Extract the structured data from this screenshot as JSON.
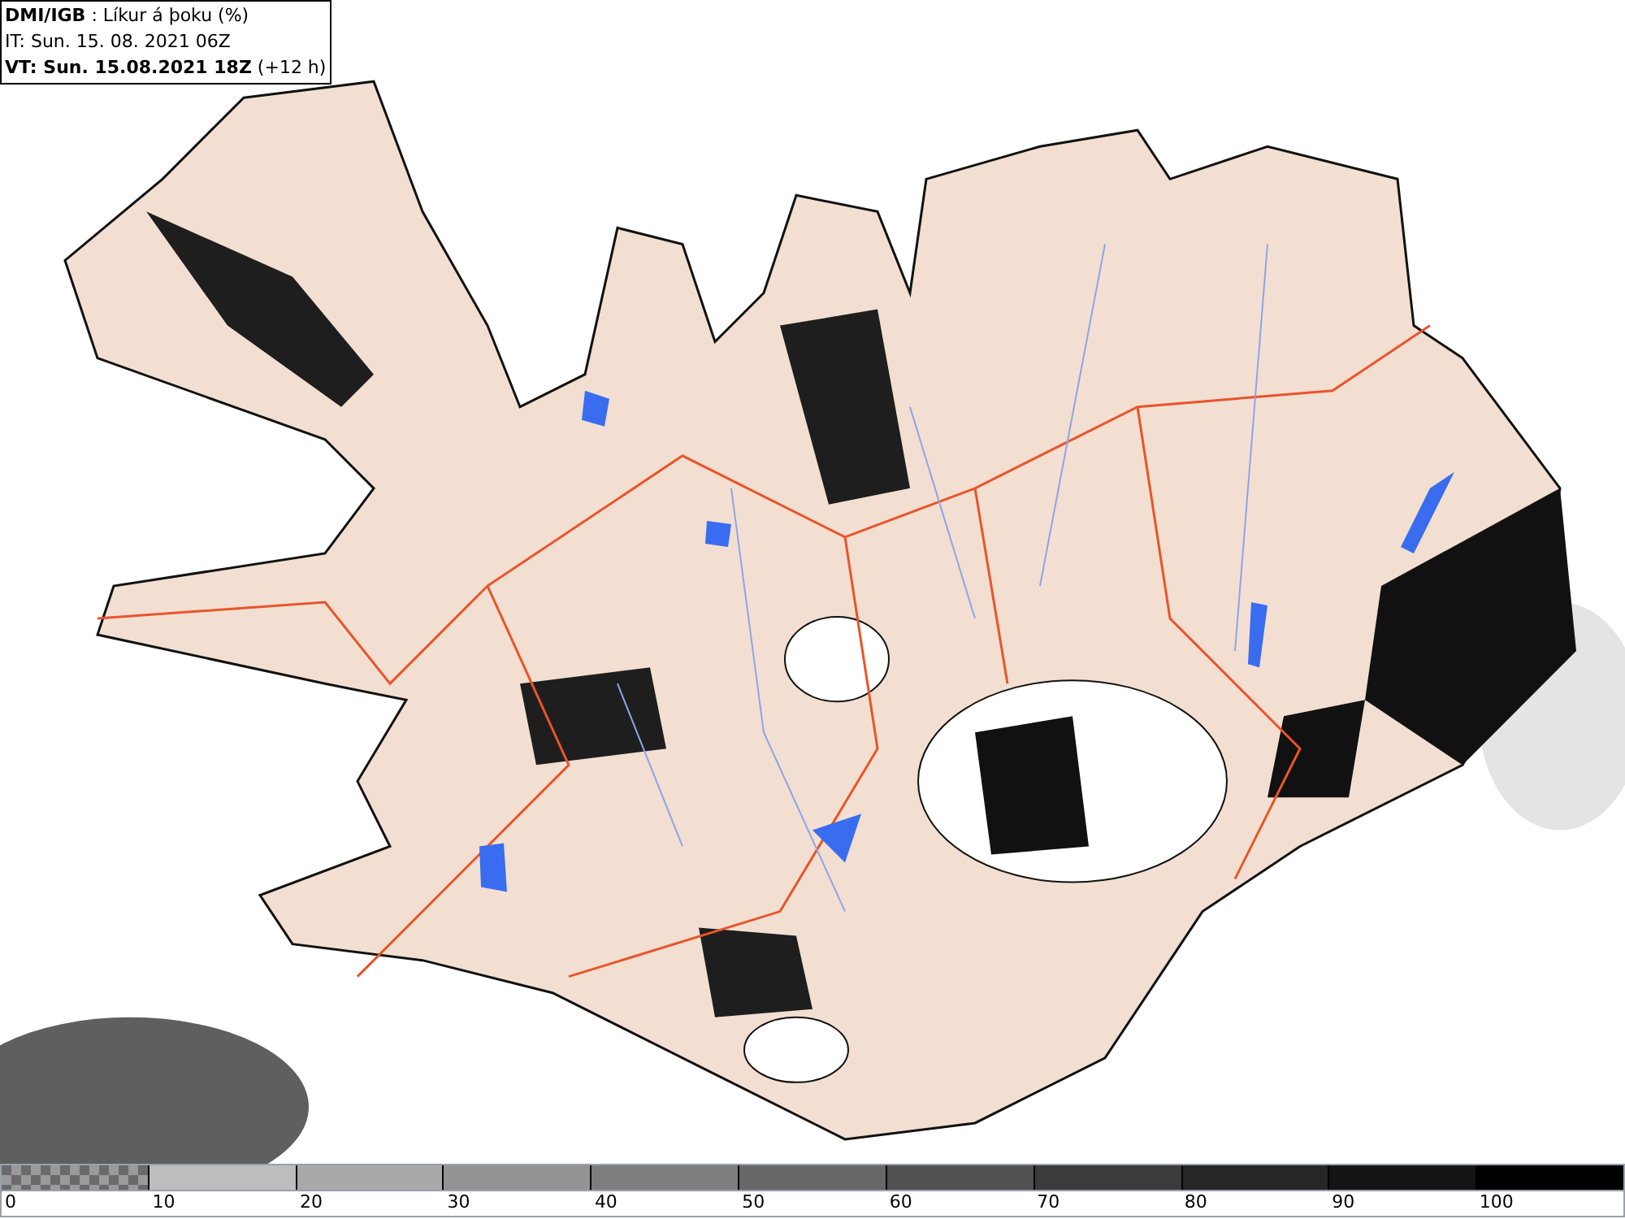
{
  "header": {
    "lines": [
      "**DMI/IGB** : Líkur á þoku (%)",
      "IT: Sun. 15. 08. 2021 06Z",
      "**VT: Sun. 15.08.2021 18Z** (+12 h)"
    ]
  },
  "legend": {
    "segments": [
      {
        "kind": "checker",
        "color": "#6a6a6a"
      },
      {
        "kind": "solid",
        "color": "#bdbdbd"
      },
      {
        "kind": "solid",
        "color": "#a9a9a9"
      },
      {
        "kind": "solid",
        "color": "#939393"
      },
      {
        "kind": "solid",
        "color": "#7d7d7d"
      },
      {
        "kind": "solid",
        "color": "#676767"
      },
      {
        "kind": "solid",
        "color": "#515151"
      },
      {
        "kind": "solid",
        "color": "#3b3b3b"
      },
      {
        "kind": "solid",
        "color": "#262626"
      },
      {
        "kind": "solid",
        "color": "#141414"
      },
      {
        "kind": "solid",
        "color": "#000000"
      }
    ],
    "labels": [
      "0",
      "10",
      "20",
      "30",
      "40",
      "50",
      "60",
      "70",
      "80",
      "90",
      "100"
    ]
  }
}
